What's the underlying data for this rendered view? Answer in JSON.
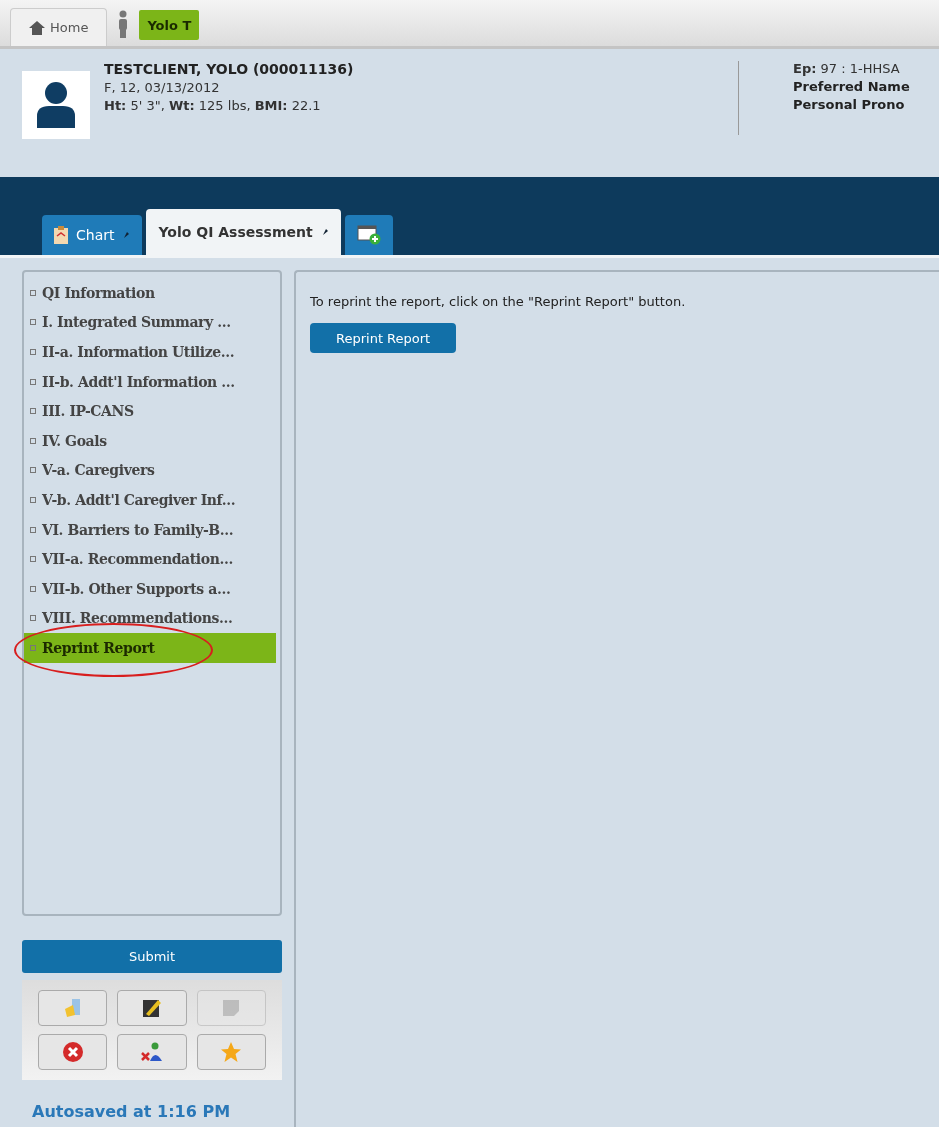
{
  "top_tabs": [
    {
      "kind": "home",
      "label": "Home",
      "selected": false
    },
    {
      "kind": "client",
      "label": "Yolo T",
      "selected": true
    }
  ],
  "client": {
    "name": "TESTCLIENT, YOLO (000011136)",
    "demographics": "F, 12, 03/13/2012",
    "vitals": "**Ht:** 5' 3\", **Wt:** 125 lbs, **BMI:** 22.1",
    "episode": "**Ep:** 97 : 1-HHSA",
    "preferred_name": "Preferred Name",
    "pronouns": "Personal Prono"
  },
  "tabs": [
    {
      "kind": "chart",
      "label": "Chart",
      "selected": false
    },
    {
      "kind": "assessment",
      "label": "Yolo QI Assessment",
      "selected": true
    },
    {
      "kind": "add",
      "selected": false
    }
  ],
  "sections": [
    {
      "label": "QI Information",
      "selected": false
    },
    {
      "label": "I. Integrated Summary ...",
      "selected": false
    },
    {
      "label": "II-a. Information Utilize...",
      "selected": false
    },
    {
      "label": "II-b. Addt'l Information ...",
      "selected": false
    },
    {
      "label": "III. IP-CANS",
      "selected": false
    },
    {
      "label": "IV. Goals",
      "selected": false
    },
    {
      "label": "V-a. Caregivers",
      "selected": false
    },
    {
      "label": "V-b. Addt'l Caregiver Inf...",
      "selected": false
    },
    {
      "label": "VI. Barriers to Family-B...",
      "selected": false
    },
    {
      "label": "VII-a. Recommendation...",
      "selected": false
    },
    {
      "label": "VII-b. Other Supports a...",
      "selected": false
    },
    {
      "label": "VIII. Recommendations...",
      "selected": false
    },
    {
      "label": "Reprint Report",
      "selected": true
    }
  ],
  "submit": "Submit",
  "tools": [
    {
      "kind": "documents",
      "disabled": false
    },
    {
      "kind": "sign",
      "disabled": false
    },
    {
      "kind": "note",
      "disabled": true
    },
    {
      "kind": "cancel",
      "disabled": false
    },
    {
      "kind": "people",
      "disabled": false
    },
    {
      "kind": "favorite",
      "disabled": false
    }
  ],
  "autosaved": "Autosaved at 1:16 PM",
  "content": {
    "instruction": "To reprint the report, click on the \"Reprint Report\" button.",
    "button": "Reprint Report"
  }
}
